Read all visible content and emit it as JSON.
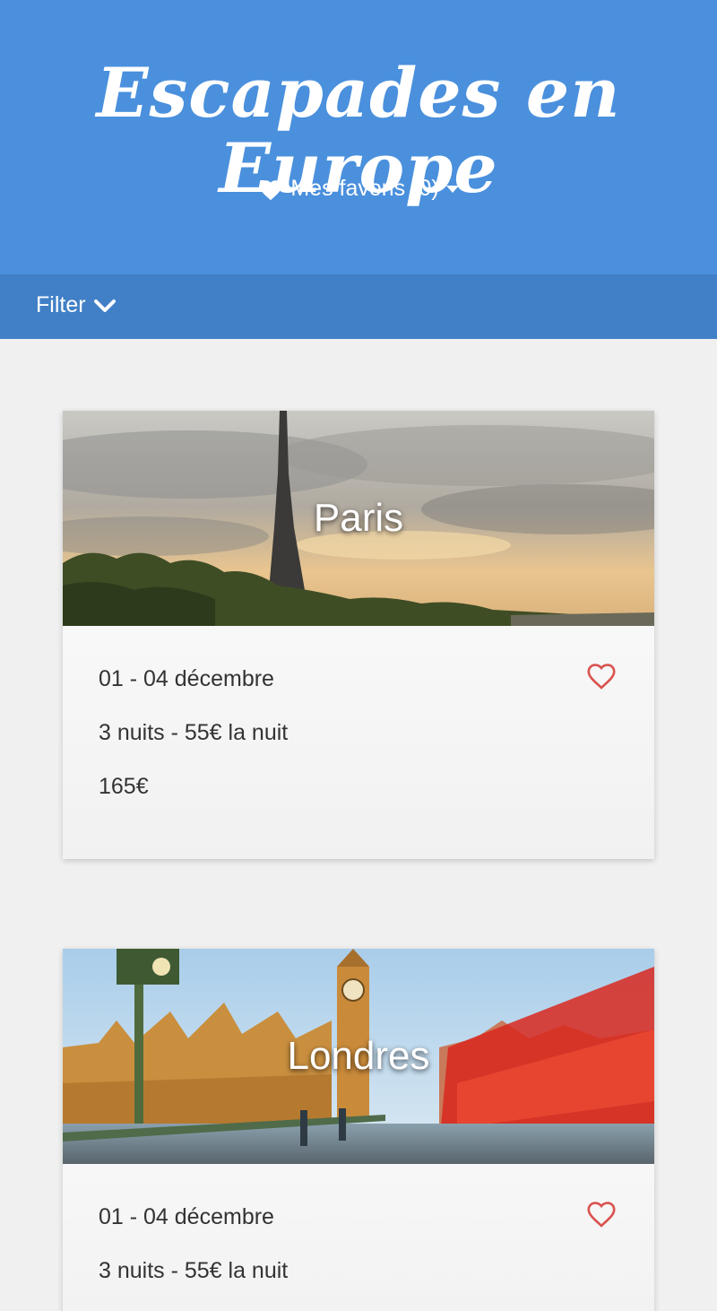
{
  "header": {
    "title": "Escapades en Europe",
    "favorites_label": "Mes favoris (0)",
    "favorites_icon": "heart-icon"
  },
  "filter": {
    "label": "Filter",
    "icon": "chevron-down-icon"
  },
  "colors": {
    "header_bg": "#4a90dd",
    "filterbar_bg": "#4180c6",
    "page_bg": "#f0f0f0",
    "heart": "#d9534f",
    "text": "#333333"
  },
  "trips": [
    {
      "city": "Paris",
      "dates": "01 - 04 décembre",
      "nights": "3 nuits - 55€ la nuit",
      "total": "165€"
    },
    {
      "city": "Londres",
      "dates": "01 - 04 décembre",
      "nights": "3 nuits - 55€ la nuit",
      "total": ""
    }
  ]
}
